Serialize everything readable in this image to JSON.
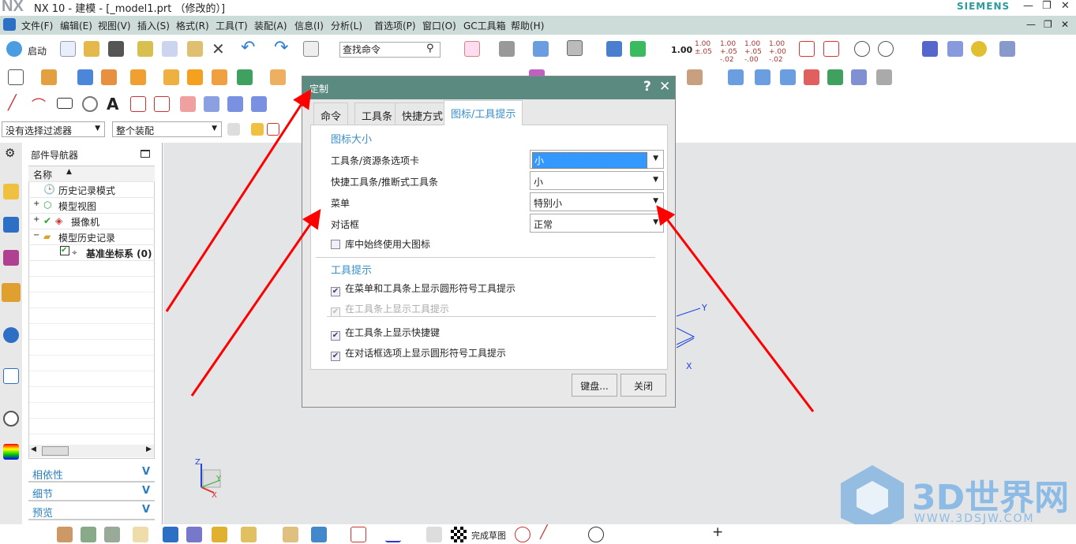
{
  "app": {
    "logo": "NX",
    "title": "NX 10 - 建模 - [_model1.prt （修改的）]",
    "brand": "SIEMENS",
    "window_controls": [
      "minimize",
      "restore",
      "close"
    ]
  },
  "menu": [
    "文件(F)",
    "编辑(E)",
    "视图(V)",
    "插入(S)",
    "格式(R)",
    "工具(T)",
    "装配(A)",
    "信息(I)",
    "分析(L)",
    "首选项(P)",
    "窗口(O)",
    "GC工具箱",
    "帮助(H)"
  ],
  "toolbar": {
    "start_label": "启动",
    "search_placeholder": "查找命令",
    "dims": [
      "1.00",
      "1.00 ±.05",
      "1.00 +.05 -.02",
      "1.00 +.05 -.00",
      "1.00 +.00 -.02"
    ]
  },
  "filter": {
    "selection_filter": "没有选择过滤器",
    "assembly_scope": "整个装配"
  },
  "navigator": {
    "title": "部件导航器",
    "column": "名称",
    "items": [
      {
        "label": "历史记录模式"
      },
      {
        "label": "模型视图"
      },
      {
        "label": "摄像机"
      },
      {
        "label": "模型历史记录"
      },
      {
        "label": "基准坐标系 (0)"
      }
    ],
    "panels": [
      "相依性",
      "细节",
      "预览"
    ]
  },
  "dialog": {
    "title": "定制",
    "tabs": [
      "命令",
      "工具条",
      "快捷方式",
      "图标/工具提示"
    ],
    "active_tab": "图标/工具提示",
    "icon_size": {
      "heading": "图标大小",
      "rows": [
        {
          "label": "工具条/资源条选项卡",
          "value": "小"
        },
        {
          "label": "快捷工具条/推断式工具条",
          "value": "小"
        },
        {
          "label": "菜单",
          "value": "特别小"
        },
        {
          "label": "对话框",
          "value": "正常"
        }
      ],
      "large_icons": {
        "label": "库中始终使用大图标",
        "checked": false
      }
    },
    "tooltips": {
      "heading": "工具提示",
      "options": [
        {
          "label": "在菜单和工具条上显示圆形符号工具提示",
          "checked": true
        },
        {
          "label": "在工具条上显示工具提示",
          "checked": true,
          "disabled": true
        },
        {
          "label": "在工具条上显示快捷键",
          "checked": true
        },
        {
          "label": "在对话框选项上显示圆形符号工具提示",
          "checked": true
        }
      ]
    },
    "buttons": {
      "keyboard": "键盘...",
      "close": "关闭"
    }
  },
  "viewport": {
    "axes": {
      "x": "X",
      "y": "Y",
      "z": "Z"
    }
  },
  "bottom_toolbar": {
    "finish_sketch": "完成草图"
  },
  "watermark": {
    "text": "3D世界网",
    "url": "WWW.3DSJW.COM"
  },
  "colors": {
    "dialog_title": "#5b8a80",
    "accent": "#3a8fc9",
    "arrow": "#ff0000",
    "selected": "#3399ff"
  }
}
